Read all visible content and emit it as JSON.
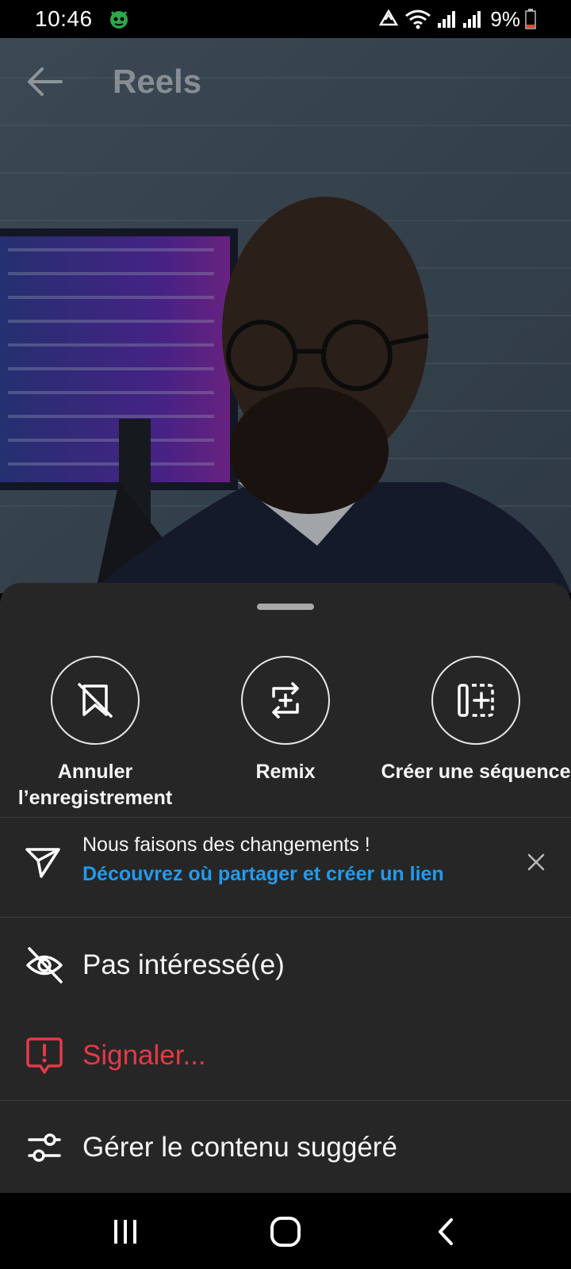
{
  "status_bar": {
    "time": "10:46",
    "battery": "9%",
    "icons": [
      "app-notification-icon",
      "recycle-icon",
      "wifi-icon",
      "signal-icon",
      "signal-icon",
      "battery-icon"
    ]
  },
  "topnav": {
    "title": "Reels",
    "back_icon": "arrow-left-icon"
  },
  "sheet": {
    "actions": [
      {
        "label": "Annuler l’enregistrement",
        "icon": "bookmark-slash-icon"
      },
      {
        "label": "Remix",
        "icon": "remix-icon"
      },
      {
        "label": "Créer une séquence",
        "icon": "sequence-icon"
      }
    ],
    "notice": {
      "title": "Nous faisons des changements !",
      "link": "Découvrez où partager et créer un lien",
      "icon": "send-icon",
      "close_icon": "close-icon"
    },
    "menu": [
      {
        "label": "Pas intéressé(e)",
        "icon": "eye-slash-icon"
      },
      {
        "label": "Signaler...",
        "icon": "report-icon",
        "color": "#e53946"
      },
      {
        "label": "Gérer le contenu suggéré",
        "icon": "sliders-icon"
      }
    ]
  },
  "navbar": {
    "icons": [
      "recent-apps-icon",
      "home-icon",
      "back-icon"
    ]
  },
  "colors": {
    "sheet_bg": "#262626",
    "link": "#1f9bf0",
    "danger": "#e53946"
  }
}
